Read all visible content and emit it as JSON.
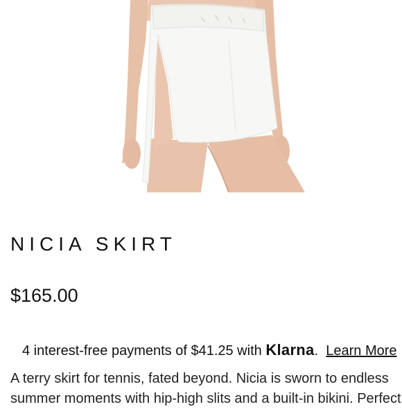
{
  "product": {
    "image_alt": "Model wearing white terry mini skirt with side slit",
    "title": "NICIA SKIRT",
    "price": "$165.00"
  },
  "klarna": {
    "prefix": "4 interest-free payments of $41.25 with",
    "logo": "Klarna",
    "dot": ".",
    "learn_more": "Learn More"
  },
  "description": {
    "line1": "A terry skirt for tennis, fated beyond. Nicia is sworn to endless",
    "line2": "summer moments with hip-high slits and a built-in bikini. Perfect"
  },
  "colors": {
    "skirt": "#f7f7f5",
    "skin": "#e9c3ab",
    "text": "#111111"
  }
}
